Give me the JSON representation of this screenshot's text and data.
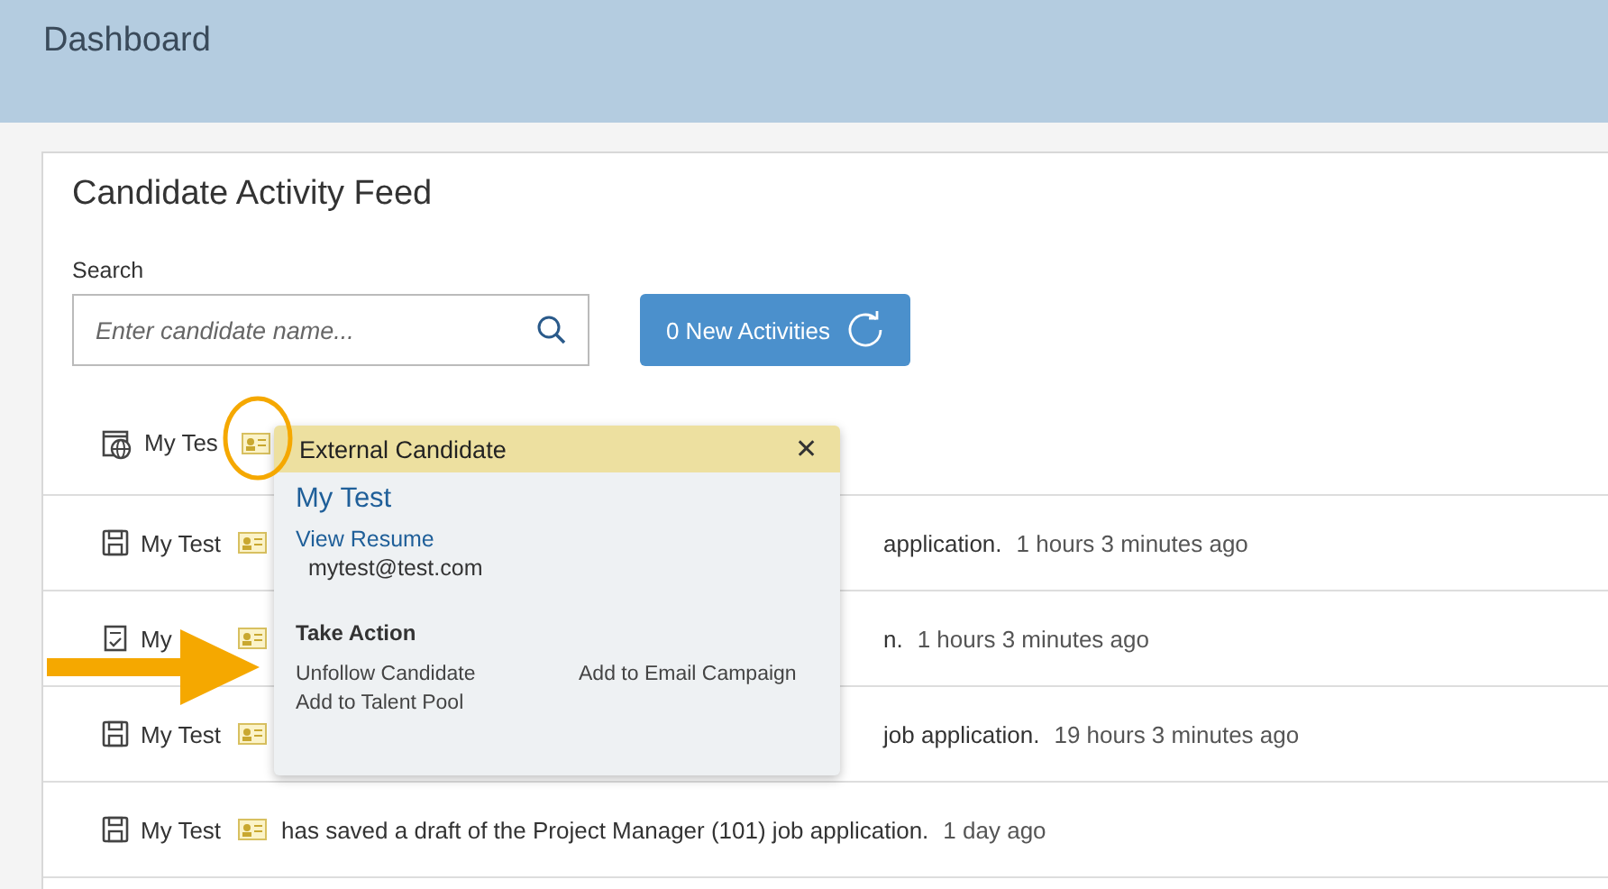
{
  "header": {
    "title": "Dashboard"
  },
  "feed": {
    "title": "Candidate Activity Feed",
    "search": {
      "label": "Search",
      "placeholder": "Enter candidate name..."
    },
    "refresh_button": "0 New Activities",
    "rows": [
      {
        "kind": "scheduled",
        "name": "My Tes"
      },
      {
        "kind": "saved",
        "covered": true,
        "name": "My Test",
        "description": "application.",
        "time": "1 hours 3 minutes ago"
      },
      {
        "kind": "applied",
        "covered": true,
        "name": "My",
        "description": "n.",
        "time": "1 hours 3 minutes ago"
      },
      {
        "kind": "saved",
        "covered": true,
        "name": "My Test",
        "description": "job application.",
        "time": "19 hours 3 minutes ago"
      },
      {
        "kind": "saved",
        "covered": false,
        "name": "My Test",
        "description": "has saved a draft of the Project Manager (101) job application.",
        "time": "1 day ago"
      }
    ]
  },
  "popover": {
    "title": "External Candidate",
    "close": "✕",
    "name": "My Test",
    "link": "View Resume",
    "email": "mytest@test.com",
    "section": "Take Action",
    "actions": [
      "Unfollow Candidate",
      "Add to Email Campaign",
      "Add to Talent Pool"
    ]
  }
}
